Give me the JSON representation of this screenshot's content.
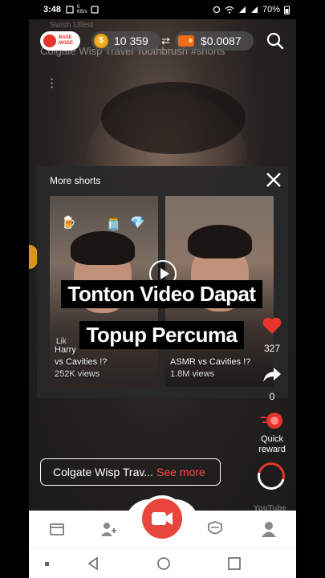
{
  "status_bar": {
    "time": "3:48",
    "net_speed": "0\nKB/s",
    "battery": "70%"
  },
  "top_bar": {
    "base_mode_label": "BASE\nMODE",
    "coin_balance": "10 359",
    "swap_symbol": "⇄",
    "cash_balance": "$0.0087"
  },
  "video": {
    "title": "Colgate Wisp Travel Toothbrush #shorts",
    "channel_hint": "Swish Ullest"
  },
  "more_shorts": {
    "heading": "More shorts",
    "items": [
      {
        "title_line1": "Harry",
        "title_line2": "vs Cavities !?",
        "views": "252K views",
        "corner_text": "Lik"
      },
      {
        "title_line1": "",
        "title_line2": "ASMR vs Cavities !?",
        "views": "1.8M views"
      }
    ]
  },
  "caption_overlay": {
    "line1": "Tonton Video Dapat",
    "line2": "Topup Percuma"
  },
  "actions": {
    "like_count": "327",
    "share_count": "0",
    "quick_reward_label": "Quick\nreward"
  },
  "description": {
    "text": "Colgate Wisp Trav...",
    "see_more": "See more"
  },
  "watermark": "YouTube",
  "colors": {
    "accent": "#e6342a",
    "fab": "#e8453c",
    "see_more": "#ff4a3d",
    "coin": "#f2b01e",
    "wallet": "#f26a1b"
  },
  "icons": {
    "search": "search-icon",
    "close": "close-icon",
    "like": "heart-icon",
    "share": "share-arrow-icon",
    "quick_reward": "reward-icon",
    "nav": [
      "shop-icon",
      "add-user-icon",
      "video-camera-icon",
      "badge-icon",
      "profile-icon"
    ]
  }
}
